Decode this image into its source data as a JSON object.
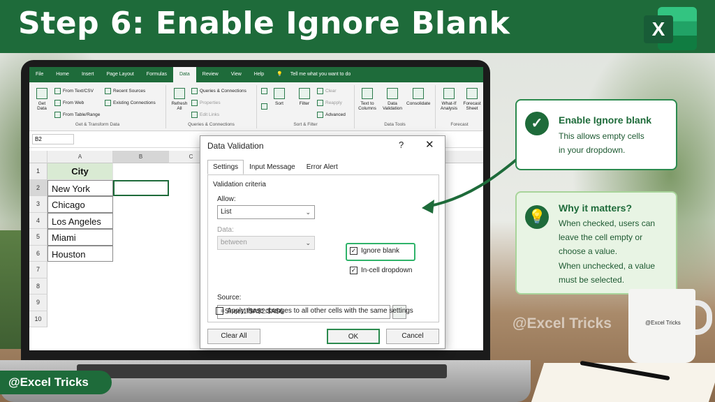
{
  "header": {
    "title": "Step 6: Enable Ignore Blank"
  },
  "excel_logo_letter": "X",
  "menu": [
    "File",
    "Home",
    "Insert",
    "Page Layout",
    "Formulas",
    "Data",
    "Review",
    "View",
    "Help"
  ],
  "tell_me": "Tell me what you want to do",
  "ribbon": {
    "get_data": "Get Data",
    "from_text": "From Text/CSV",
    "from_web": "From Web",
    "from_table": "From Table/Range",
    "recent_sources": "Recent Sources",
    "existing_conn": "Existing Connections",
    "grp_get": "Get & Transform Data",
    "refresh": "Refresh All",
    "queries": "Queries & Connections",
    "properties": "Properties",
    "edit_links": "Edit Links",
    "grp_queries": "Queries & Connections",
    "sort": "Sort",
    "filter": "Filter",
    "clear": "Clear",
    "reapply": "Reapply",
    "advanced": "Advanced",
    "grp_sort": "Sort & Filter",
    "text_to_columns": "Text to Columns",
    "data_validation": "Data Validation",
    "consolidate": "Consolidate",
    "grp_tools": "Data Tools",
    "whatif": "What-If Analysis",
    "forecast_sheet": "Forecast Sheet",
    "grp_forecast": "Forecast"
  },
  "namebox": "B2",
  "columns": [
    "A",
    "B",
    "C"
  ],
  "rows": [
    "1",
    "2",
    "3",
    "4",
    "5",
    "6",
    "7",
    "8",
    "9",
    "10"
  ],
  "city_header": "City",
  "cities": [
    "New York",
    "Chicago",
    "Los Angeles",
    "Miami",
    "Houston"
  ],
  "dialog": {
    "title": "Data Validation",
    "help": "?",
    "close": "✕",
    "tabs": [
      "Settings",
      "Input Message",
      "Error Alert"
    ],
    "criteria": "Validation criteria",
    "allow_label": "Allow:",
    "allow_value": "List",
    "data_label": "Data:",
    "data_value": "between",
    "ignore_blank": "Ignore blank",
    "incell": "In-cell dropdown",
    "source_label": "Source:",
    "source_value": "=Sheet1!$A$2:$A$6",
    "apply_all": "Apply these changes to all other cells with the same settings",
    "clear_all": "Clear All",
    "ok": "OK",
    "cancel": "Cancel"
  },
  "callout1": {
    "heading": "Enable Ignore blank",
    "line1": "This allows empty cells",
    "line2": "in your dropdown."
  },
  "callout2": {
    "heading": "Why it matters?",
    "l1": "When checked, users can",
    "l2": "leave the cell empty or",
    "l3": "choose a value.",
    "l4": "When unchecked, a value",
    "l5": "must be selected."
  },
  "watermark": "@Excel Tricks",
  "mug_text": "@Excel Tricks",
  "handle": "@Excel Tricks",
  "colors": {
    "green": "#1e6b3a",
    "highlight": "#2fb36a"
  }
}
